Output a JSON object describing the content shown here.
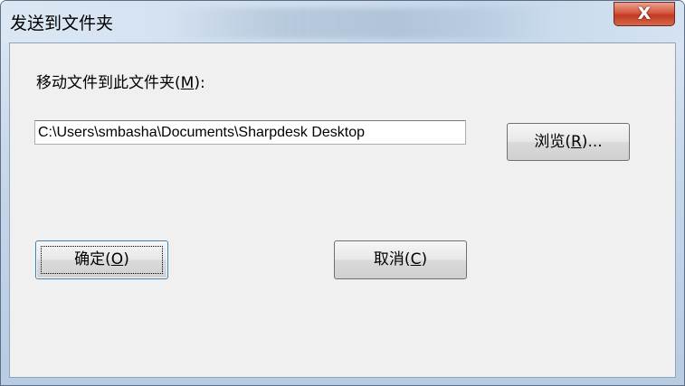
{
  "window": {
    "title": "发送到文件夹",
    "close_glyph": "X"
  },
  "dialog": {
    "label_text": "移动文件到此文件夹",
    "label_mnemonic": "M",
    "path_value": "C:\\Users\\smbasha\\Documents\\Sharpdesk Desktop",
    "browse_label": "浏览",
    "browse_mnemonic": "R",
    "browse_suffix": "...",
    "ok_label": "确定",
    "ok_mnemonic": "O",
    "cancel_label": "取消",
    "cancel_mnemonic": "C"
  },
  "colors": {
    "close_button": "#c23a22",
    "client_bg": "#f0f0f0",
    "default_button_border": "#3c7fb1"
  },
  "icons": {
    "close": "close-icon"
  }
}
